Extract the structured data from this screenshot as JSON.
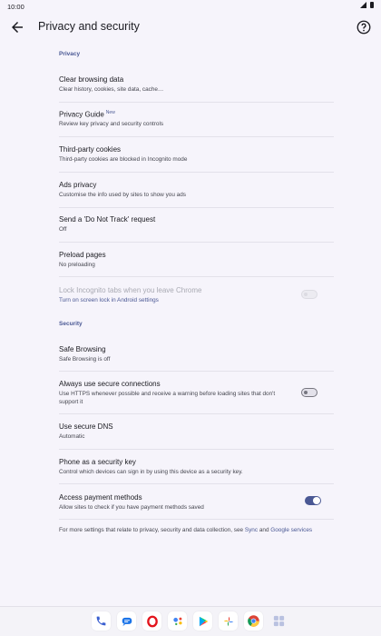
{
  "status_bar": {
    "time": "10:00"
  },
  "app_bar": {
    "title": "Privacy and security"
  },
  "sections": {
    "privacy": "Privacy",
    "security": "Security"
  },
  "privacy_items": [
    {
      "title": "Clear browsing data",
      "subtitle": "Clear history, cookies, site data, cache…"
    },
    {
      "title": "Privacy Guide",
      "badge": "New",
      "subtitle": "Review key privacy and security controls"
    },
    {
      "title": "Third-party cookies",
      "subtitle": "Third-party cookies are blocked in Incognito mode"
    },
    {
      "title": "Ads privacy",
      "subtitle": "Customise the info used by sites to show you ads"
    },
    {
      "title": "Send a 'Do Not Track' request",
      "subtitle": "Off"
    },
    {
      "title": "Preload pages",
      "subtitle": "No preloading"
    },
    {
      "title": "Lock Incognito tabs when you leave Chrome",
      "subtitle": "Turn on screen lock in Android settings",
      "enabled": false,
      "toggle": false
    }
  ],
  "security_items": [
    {
      "title": "Safe Browsing",
      "subtitle": "Safe Browsing is off"
    },
    {
      "title": "Always use secure connections",
      "subtitle": "Use HTTPS whenever possible and receive a warning before loading sites that don't support it",
      "toggle": false
    },
    {
      "title": "Use secure DNS",
      "subtitle": "Automatic"
    },
    {
      "title": "Phone as a security key",
      "subtitle": "Control which devices can sign in by using this device as a security key."
    },
    {
      "title": "Access payment methods",
      "subtitle": "Allow sites to check if you have payment methods saved",
      "toggle": true
    }
  ],
  "footer": {
    "text": "For more settings that relate to privacy, security and data collection, see ",
    "link1": "Sync",
    "and": " and ",
    "link2": "Google services"
  },
  "dock_icons": [
    "phone-icon",
    "messages-icon",
    "opera-icon",
    "assistant-icon",
    "play-store-icon",
    "photos-icon",
    "chrome-icon",
    "apps-grid-icon"
  ],
  "colors": {
    "accent": "#4a5894",
    "background": "#f6f4fb"
  }
}
